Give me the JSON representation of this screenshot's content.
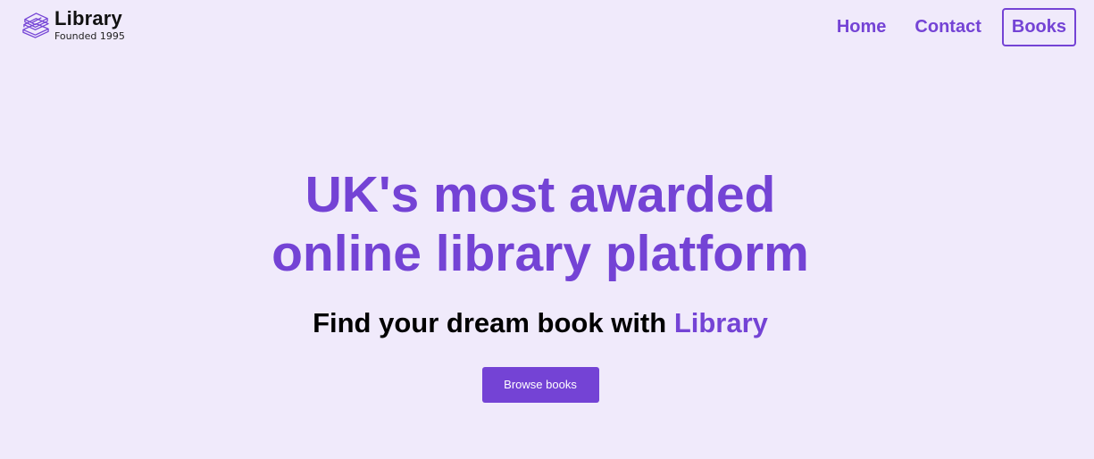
{
  "brand": {
    "title": "Library",
    "subtitle": "Founded 1995",
    "icon": "stacked-books-icon"
  },
  "nav": {
    "items": [
      {
        "label": "Home",
        "active": false
      },
      {
        "label": "Contact",
        "active": false
      },
      {
        "label": "Books",
        "active": true
      }
    ]
  },
  "hero": {
    "title": "UK's most awarded online library platform",
    "subtitle_prefix": "Find your dream book with ",
    "subtitle_accent": "Library",
    "cta_label": "Browse books"
  },
  "colors": {
    "background": "#f0eafb",
    "accent": "#7443d5",
    "text": "#000000",
    "button_text": "#ffffff"
  }
}
